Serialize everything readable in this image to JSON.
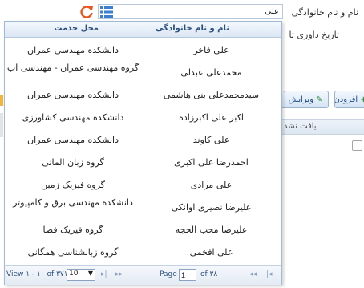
{
  "form": {
    "fullname_label": "نام و نام خانوادگی",
    "date_label": "تاریخ داوری تا",
    "search_value": "علی"
  },
  "toolbar": {
    "add_label": "افزودن",
    "edit_label": "ویرایش",
    "third_label": "ه"
  },
  "grid": {
    "header_label": "یافت نشد"
  },
  "dropdown": {
    "columns": {
      "name": "نام و نام خانوادگی",
      "unit": "محل خدمت"
    },
    "rows": [
      {
        "name": "علی فاخر",
        "unit": "دانشکده مهندسی عمران"
      },
      {
        "name": "محمدعلی عبدلی",
        "unit": "گروه مهندسی عمران - مهندسی آب"
      },
      {
        "name": "سیدمحمدعلی بنی هاشمی",
        "unit": "دانشکده مهندسی عمران"
      },
      {
        "name": "اکبر علی اکبرزاده",
        "unit": "دانشکده مهندسی کشاورزی"
      },
      {
        "name": "علی کاوند",
        "unit": "دانشکده مهندسی عمران"
      },
      {
        "name": "احمدرضا علی اکبری",
        "unit": "گروه زبان المانی"
      },
      {
        "name": "علی مرادی",
        "unit": "گروه فیزیک زمین"
      },
      {
        "name": "علیرضا نصیری اوانکی",
        "unit": "دانشکده مهندسی برق و کامپیوتر"
      },
      {
        "name": "علیرضا محب الحجه",
        "unit": "گروه فیزیک فضا"
      },
      {
        "name": "علی افخمی",
        "unit": "گروه زبانشناسی همگانی"
      }
    ],
    "pager": {
      "view_text": "View ۱ - ۱۰ of ۳۷۱",
      "page_size": "10",
      "page_label": "Page",
      "page_value": "1",
      "of_pages": "of ۳۸"
    }
  },
  "colors": {
    "accent": "#2a4f7c",
    "refresh_icon": "#e8571e",
    "list_icon": "#3a7fd0"
  },
  "icons": [
    "refresh-icon",
    "list-icon",
    "plus-icon",
    "edit-icon",
    "first-page-icon",
    "prev-page-icon",
    "next-page-icon",
    "last-page-icon"
  ]
}
